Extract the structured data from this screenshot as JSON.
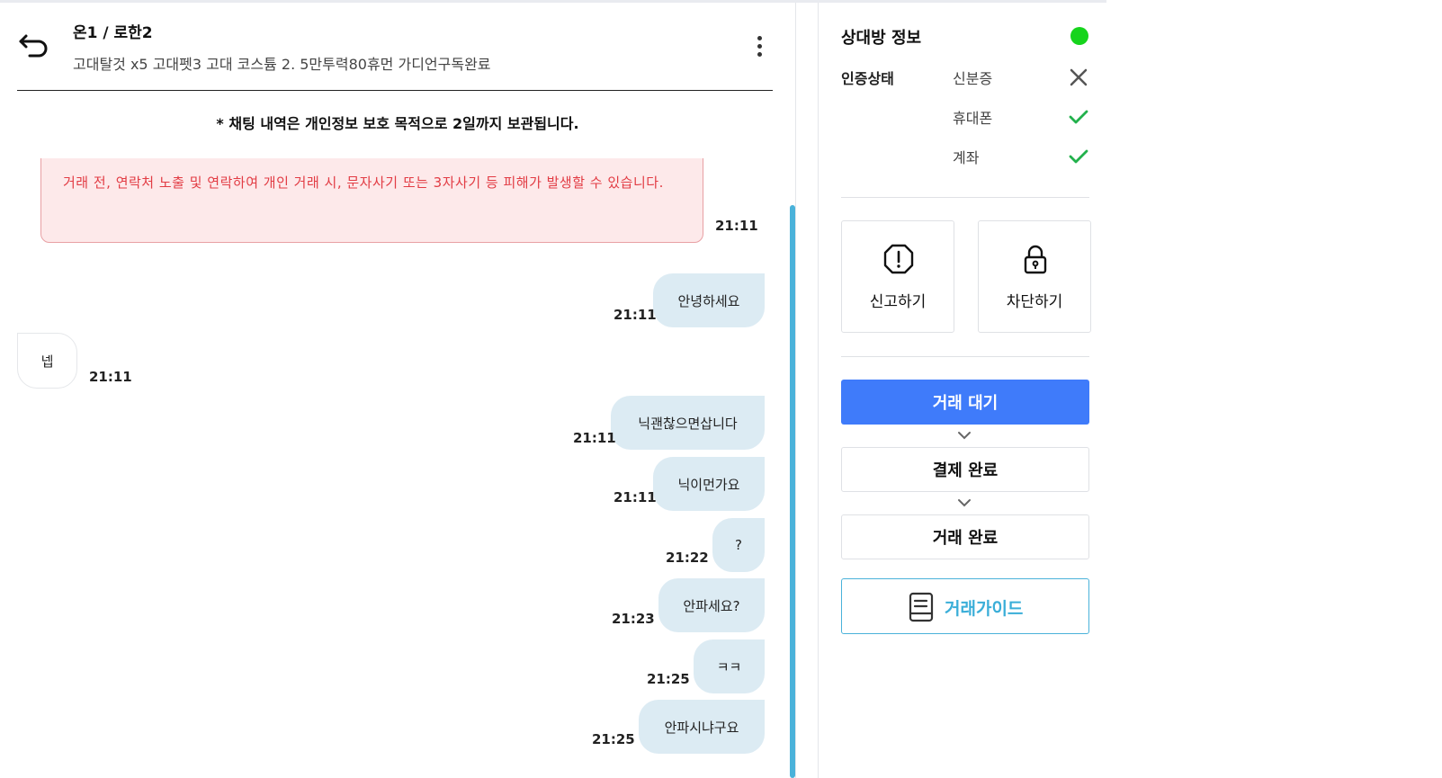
{
  "chat": {
    "title": "온1 / 로한2",
    "subtitle": "고대탈것 x5 고대펫3 고대 코스튬 2. 5만투력80휴먼 가디언구독완료",
    "notice": "* 채팅 내역은 개인정보 보호 목적으로 2일까지 보관됩니다.",
    "warning": {
      "text": "거래 전, 연락처 노출 및 연락하여 개인 거래 시, 문자사기 또는 3자사기 등 피해가 발생할 수 있습니다.",
      "time": "21:11"
    },
    "messages": [
      {
        "from": "me",
        "text": "안녕하세요",
        "time": "21:11"
      },
      {
        "from": "them",
        "text": "넵",
        "time": "21:11"
      },
      {
        "from": "me",
        "text": "닉괜찮으면삽니다",
        "time": "21:11"
      },
      {
        "from": "me",
        "text": "닉이먼가요",
        "time": "21:11"
      },
      {
        "from": "me",
        "text": "?",
        "time": "21:22"
      },
      {
        "from": "me",
        "text": "안파세요?",
        "time": "21:23"
      },
      {
        "from": "me",
        "text": "ㅋㅋ",
        "time": "21:25"
      },
      {
        "from": "me",
        "text": "안파시냐구요",
        "time": "21:25"
      }
    ]
  },
  "info": {
    "title": "상대방 정보",
    "online_color": "#16d41c",
    "verify_label": "인증상태",
    "verifications": [
      {
        "label": "신분증",
        "status": "unverified",
        "icon": "x-icon"
      },
      {
        "label": "휴대폰",
        "status": "verified",
        "icon": "check-icon"
      },
      {
        "label": "계좌",
        "status": "verified",
        "icon": "check-icon"
      }
    ],
    "report_label": "신고하기",
    "block_label": "차단하기",
    "steps": [
      {
        "label": "거래 대기",
        "active": true
      },
      {
        "label": "결제 완료",
        "active": false
      },
      {
        "label": "거래 완료",
        "active": false
      }
    ],
    "guide_label": "거래가이드",
    "accent_color": "#3f7bfa",
    "guide_color": "#3aaed8"
  }
}
